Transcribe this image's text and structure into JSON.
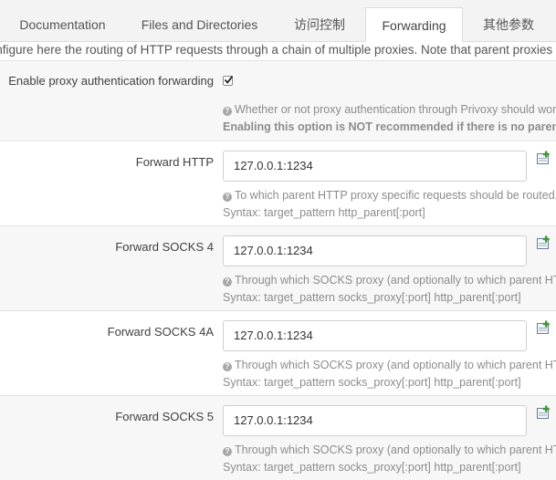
{
  "tabs": [
    {
      "label": "Documentation",
      "active": false
    },
    {
      "label": "Files and Directories",
      "active": false
    },
    {
      "label": "访问控制",
      "active": false
    },
    {
      "label": "Forwarding",
      "active": true
    },
    {
      "label": "其他参数",
      "active": false
    }
  ],
  "description": "Configure here the routing of HTTP requests through a chain of multiple proxies. Note that parent proxies can severely",
  "auth_forwarding": {
    "label": "Enable proxy authentication forwarding",
    "checked": true,
    "help_line1": "Whether or not proxy authentication through Privoxy should work.",
    "help_line2": "Enabling this option is NOT recommended if there is no parent proxy that requires authentication."
  },
  "fields": [
    {
      "label": "Forward HTTP",
      "value": "127.0.0.1:1234",
      "help_line1": "To which parent HTTP proxy specific requests should be routed.",
      "help_line2": "Syntax: target_pattern http_parent[:port]"
    },
    {
      "label": "Forward SOCKS 4",
      "value": "127.0.0.1:1234",
      "help_line1": "Through which SOCKS proxy (and optionally to which parent HTTP proxy) specific requests should be routed.",
      "help_line2": "Syntax: target_pattern socks_proxy[:port] http_parent[:port]"
    },
    {
      "label": "Forward SOCKS 4A",
      "value": "127.0.0.1:1234",
      "help_line1": "Through which SOCKS proxy (and optionally to which parent HTTP proxy) specific requests should be routed.",
      "help_line2": "Syntax: target_pattern socks_proxy[:port] http_parent[:port]"
    },
    {
      "label": "Forward SOCKS 5",
      "value": "127.0.0.1:1234",
      "help_line1": "Through which SOCKS proxy (and optionally to which parent HTTP proxy) specific requests should be routed.",
      "help_line2": "Syntax: target_pattern socks_proxy[:port] http_parent[:port]"
    }
  ],
  "help_icon_glyph": "?",
  "icons": {
    "help": "question-circle-icon",
    "add": "add-entry-icon",
    "check": "checkmark-icon"
  },
  "colors": {
    "tab_bar": "#f3f3f3",
    "section_alt": "#f7f7f7",
    "help_text": "#8c8c8c",
    "add_icon_green": "#3a9a2e"
  }
}
